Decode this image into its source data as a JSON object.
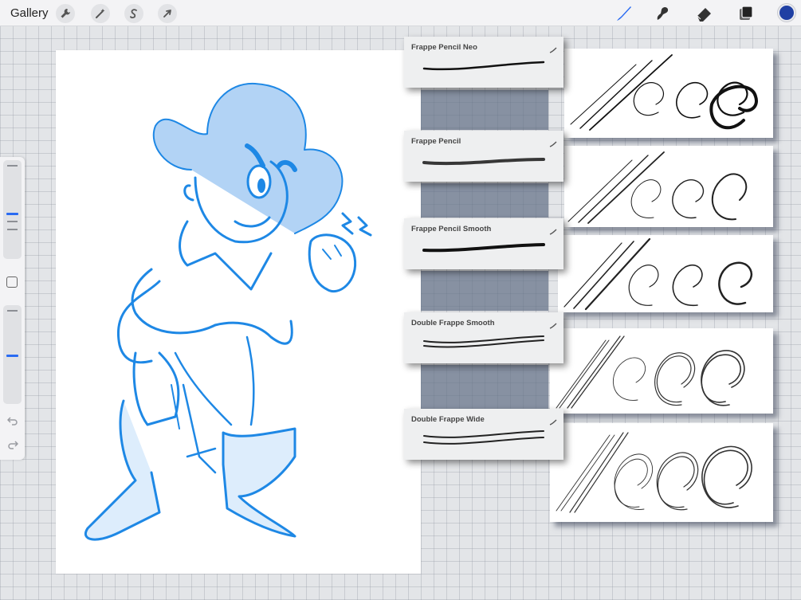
{
  "topbar": {
    "gallery_label": "Gallery",
    "left_tools": [
      "wrench-icon",
      "magic-wand-icon",
      "selection-s-icon",
      "arrow-cursor-icon"
    ],
    "right_tools": [
      "brush-icon",
      "smudge-icon",
      "eraser-icon",
      "layers-icon"
    ],
    "active_tool": "brush-icon",
    "active_color": "#1f3fa3"
  },
  "sidebar": {
    "items": [
      "size-slider",
      "modify-button",
      "opacity-slider",
      "undo-icon",
      "redo-icon"
    ]
  },
  "brushes": [
    {
      "name": "Frappe Pencil Neo"
    },
    {
      "name": "Frappe Pencil"
    },
    {
      "name": "Frappe Pencil Smooth"
    },
    {
      "name": "Double Frappe Smooth"
    },
    {
      "name": "Double Frappe Wide"
    }
  ],
  "colors": {
    "accent": "#2a6bf2",
    "sketch_blue": "#1e88e5",
    "panel_shadow": "#5f6d85"
  }
}
